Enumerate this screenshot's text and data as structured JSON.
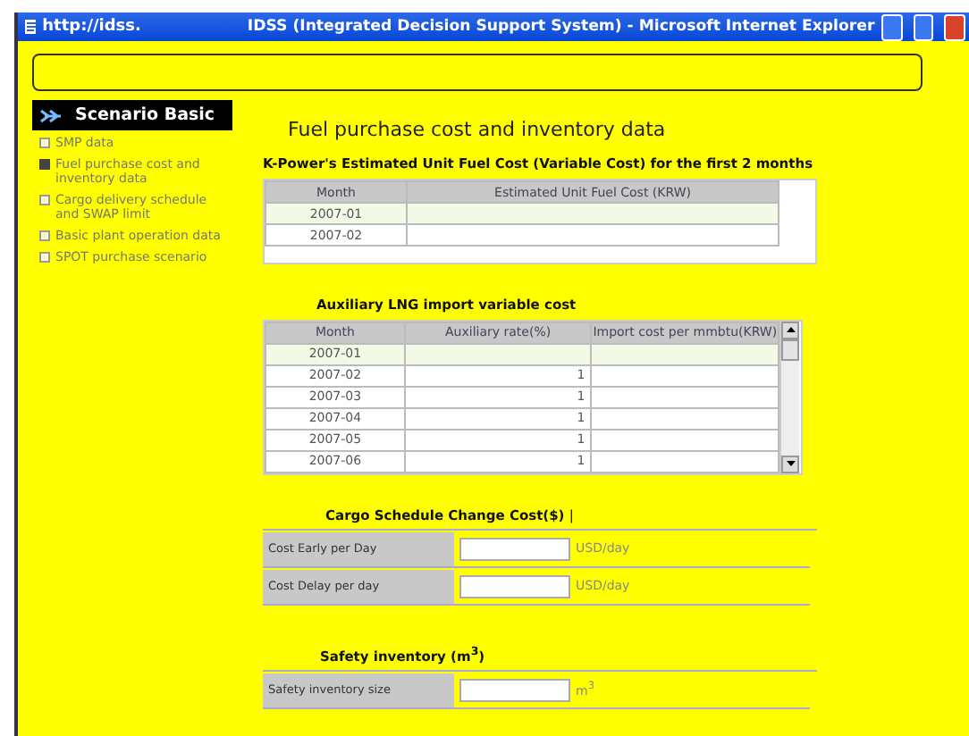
{
  "window": {
    "address": "http://idss.",
    "title": "IDSS (Integrated Decision Support System) - Microsoft Internet Explorer"
  },
  "sidebar": {
    "title": "Scenario Basic",
    "items": [
      {
        "label": "SMP data",
        "selected": false
      },
      {
        "label": "Fuel purchase cost and inventory data",
        "selected": true
      },
      {
        "label": "Cargo delivery schedule and SWAP limit",
        "selected": false
      },
      {
        "label": "Basic plant operation data",
        "selected": false
      },
      {
        "label": "SPOT purchase scenario",
        "selected": false
      }
    ]
  },
  "page_title": "Fuel purchase cost and inventory data",
  "fuel_cost_table": {
    "title": "K-Power's Estimated Unit Fuel Cost (Variable Cost) for the first 2 months",
    "columns": [
      "Month",
      "Estimated Unit Fuel Cost (KRW)"
    ],
    "rows": [
      {
        "month": "2007-01",
        "selected": true
      },
      {
        "month": "2007-02",
        "selected": false
      }
    ]
  },
  "lng_table": {
    "title": "Auxiliary LNG import variable cost",
    "columns": [
      "Month",
      "Auxiliary rate(%)",
      "Import cost per mmbtu(KRW)"
    ],
    "rows": [
      {
        "month": "2007-01",
        "rate": "",
        "selected": true
      },
      {
        "month": "2007-02",
        "rate": "1",
        "selected": false
      },
      {
        "month": "2007-03",
        "rate": "1",
        "selected": false
      },
      {
        "month": "2007-04",
        "rate": "1",
        "selected": false
      },
      {
        "month": "2007-05",
        "rate": "1",
        "selected": false
      },
      {
        "month": "2007-06",
        "rate": "1",
        "selected": false
      }
    ]
  },
  "cargo": {
    "title": "Cargo Schedule Change Cost($)",
    "mark": "|",
    "fields": [
      {
        "label": "Cost Early per Day",
        "unit": "USD/day"
      },
      {
        "label": "Cost Delay per day",
        "unit": "USD/day"
      }
    ]
  },
  "safety": {
    "title": "Safety inventory (m$^{3}$)",
    "fields": [
      {
        "label": "Safety inventory size",
        "unit": "m$^{3}$"
      }
    ]
  }
}
